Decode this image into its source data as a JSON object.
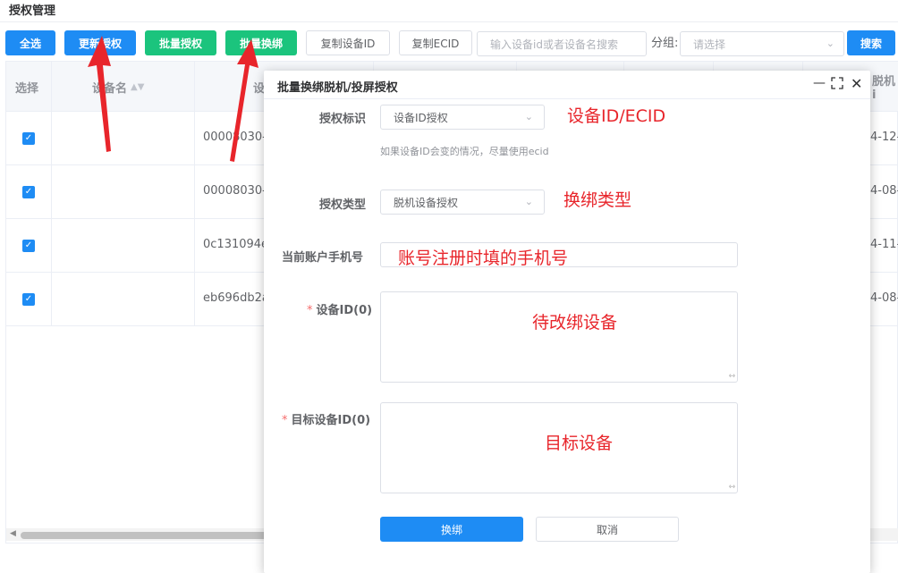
{
  "page_title": "授权管理",
  "toolbar": {
    "select_all": "全选",
    "update_auth": "更新授权",
    "batch_auth": "批量授权",
    "batch_rebind": "批量换绑",
    "copy_device_id": "复制设备ID",
    "copy_ecid": "复制ECID",
    "search_placeholder": "输入设备id或者设备名搜索",
    "group_label": "分组:",
    "group_placeholder": "请选择",
    "search_button": "搜索"
  },
  "table": {
    "columns": {
      "select": "选择",
      "device_name": "设备名",
      "device_id_partial": "设",
      "offline_partial": "脱机i"
    },
    "rows": [
      {
        "checked": true,
        "device_id": "00008030-",
        "date": "4-12-"
      },
      {
        "checked": true,
        "device_id": "00008030-",
        "date": "4-08-"
      },
      {
        "checked": true,
        "device_id": "0c131094e",
        "date": "4-11-"
      },
      {
        "checked": true,
        "device_id": "eb696db2a",
        "date": "4-08-"
      }
    ]
  },
  "modal": {
    "title": "批量换绑脱机/投屏授权",
    "auth_id_label": "授权标识",
    "auth_id_value": "设备ID授权",
    "auth_id_hint": "如果设备ID会变的情况，尽量使用ecid",
    "auth_type_label": "授权类型",
    "auth_type_value": "脱机设备授权",
    "phone_label": "当前账户手机号",
    "device_ids_label": "设备ID(0)",
    "target_ids_label": "目标设备ID(0)",
    "required_mark": "*",
    "confirm_label": "换绑",
    "cancel_label": "取消"
  },
  "annotations": {
    "auth_id_note": "设备ID/ECID",
    "auth_type_note": "换绑类型",
    "phone_note": "账号注册时填的手机号",
    "device_ids_note": "待改绑设备",
    "target_ids_note": "目标设备"
  },
  "colors": {
    "primary": "#1e8cf4",
    "success": "#1bc47d",
    "annotation": "#e8252b"
  }
}
